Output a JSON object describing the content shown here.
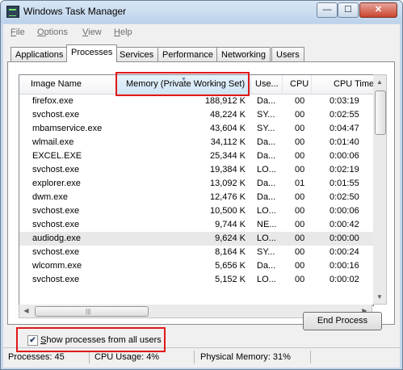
{
  "window": {
    "title": "Windows Task Manager",
    "min_glyph": "—",
    "max_glyph": "☐",
    "close_glyph": "✕"
  },
  "menu": [
    "File",
    "Options",
    "View",
    "Help"
  ],
  "tabs": [
    {
      "label": "Applications",
      "active": false
    },
    {
      "label": "Processes",
      "active": true
    },
    {
      "label": "Services",
      "active": false
    },
    {
      "label": "Performance",
      "active": false
    },
    {
      "label": "Networking",
      "active": false
    },
    {
      "label": "Users",
      "active": false
    }
  ],
  "columns": [
    "Image Name",
    "Memory (Private Working Set)",
    "Use...",
    "CPU",
    "CPU Time"
  ],
  "sorted_column": "Memory (Private Working Set)",
  "processes": [
    {
      "name": "firefox.exe",
      "memory": "188,912 K",
      "user": "Da...",
      "cpu": "00",
      "cpu_time": "0:03:19"
    },
    {
      "name": "svchost.exe",
      "memory": "48,224 K",
      "user": "SY...",
      "cpu": "00",
      "cpu_time": "0:02:55"
    },
    {
      "name": "mbamservice.exe",
      "memory": "43,604 K",
      "user": "SY...",
      "cpu": "00",
      "cpu_time": "0:04:47"
    },
    {
      "name": "wlmail.exe",
      "memory": "34,112 K",
      "user": "Da...",
      "cpu": "00",
      "cpu_time": "0:01:40"
    },
    {
      "name": "EXCEL.EXE",
      "memory": "25,344 K",
      "user": "Da...",
      "cpu": "00",
      "cpu_time": "0:00:06"
    },
    {
      "name": "svchost.exe",
      "memory": "19,384 K",
      "user": "LO...",
      "cpu": "00",
      "cpu_time": "0:02:19"
    },
    {
      "name": "explorer.exe",
      "memory": "13,092 K",
      "user": "Da...",
      "cpu": "01",
      "cpu_time": "0:01:55"
    },
    {
      "name": "dwm.exe",
      "memory": "12,476 K",
      "user": "Da...",
      "cpu": "00",
      "cpu_time": "0:02:50"
    },
    {
      "name": "svchost.exe",
      "memory": "10,500 K",
      "user": "LO...",
      "cpu": "00",
      "cpu_time": "0:00:06"
    },
    {
      "name": "svchost.exe",
      "memory": "9,744 K",
      "user": "NE...",
      "cpu": "00",
      "cpu_time": "0:00:42"
    },
    {
      "name": "audiodg.exe",
      "memory": "9,624 K",
      "user": "LO...",
      "cpu": "00",
      "cpu_time": "0:00:00",
      "selected": true
    },
    {
      "name": "svchost.exe",
      "memory": "8,164 K",
      "user": "SY...",
      "cpu": "00",
      "cpu_time": "0:00:24"
    },
    {
      "name": "wlcomm.exe",
      "memory": "5,656 K",
      "user": "Da...",
      "cpu": "00",
      "cpu_time": "0:00:16"
    },
    {
      "name": "svchost.exe",
      "memory": "5,152 K",
      "user": "LO...",
      "cpu": "00",
      "cpu_time": "0:00:02"
    }
  ],
  "show_all_users": {
    "label": "Show processes from all users",
    "checked": true,
    "check_glyph": "✔"
  },
  "end_process_button": "End Process",
  "status": {
    "processes": "Processes: 45",
    "cpu_usage": "CPU Usage: 4%",
    "physical_memory": "Physical Memory: 31%"
  },
  "colors": {
    "highlight": "#e01818",
    "titlebar": "#c6d8ec",
    "close_button": "#c9452f"
  }
}
